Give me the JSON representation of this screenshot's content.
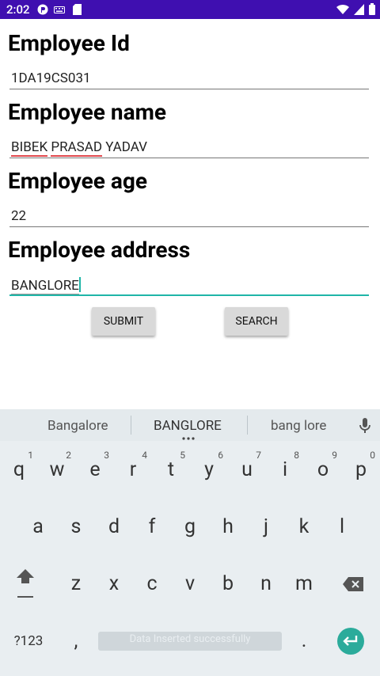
{
  "status_bar": {
    "time": "2:02"
  },
  "form": {
    "id_label": "Employee Id",
    "id_value": "1DA19CS031",
    "name_label": "Employee name",
    "name_first": "BIBEK",
    "name_middle": "PRASAD",
    "name_last": "YADAV",
    "age_label": "Employee age",
    "age_value": "22",
    "address_label": "Employee address",
    "address_value": "BANGLORE"
  },
  "buttons": {
    "submit": "SUBMIT",
    "search": "SEARCH"
  },
  "keyboard": {
    "suggestions": [
      "Bangalore",
      "BANGLORE",
      "bang lore"
    ],
    "row1": [
      "q",
      "w",
      "e",
      "r",
      "t",
      "y",
      "u",
      "i",
      "o",
      "p"
    ],
    "row1_hints": [
      "1",
      "2",
      "3",
      "4",
      "5",
      "6",
      "7",
      "8",
      "9",
      "0"
    ],
    "row2": [
      "a",
      "s",
      "d",
      "f",
      "g",
      "h",
      "j",
      "k",
      "l"
    ],
    "row3": [
      "z",
      "x",
      "c",
      "v",
      "b",
      "n",
      "m"
    ],
    "symbols_key": "?123",
    "comma": ",",
    "period": ".",
    "toast": "Data Inserted successfully"
  },
  "colors": {
    "status_bar": "#3f0fb0",
    "accent": "#1fb6a8",
    "enter_key": "#2bab9b"
  }
}
